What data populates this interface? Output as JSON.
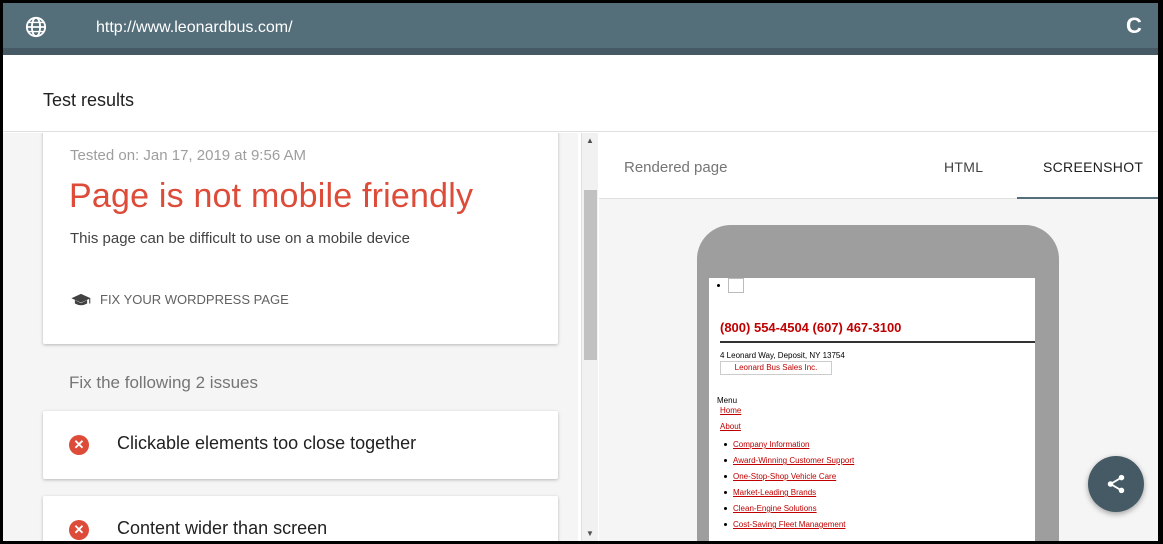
{
  "browser": {
    "url": "http://www.leonardbus.com/",
    "globe_icon": "globe-icon",
    "reload_icon": "reload-icon",
    "reload_glyph": "C"
  },
  "header": {
    "title": "Test results"
  },
  "result": {
    "tested_on": "Tested on: Jan 17, 2019 at 9:56 AM",
    "verdict": "Page is not mobile friendly",
    "subtitle": "This page can be difficult to use on a mobile device",
    "fix_link": "FIX YOUR WORDPRESS PAGE",
    "verdict_color": "#dd4b39"
  },
  "issues": {
    "title": "Fix the following 2 issues",
    "items": [
      {
        "label": "Clickable elements too close together",
        "icon": "error-icon"
      },
      {
        "label": "Content wider than screen",
        "icon": "error-icon"
      }
    ]
  },
  "preview": {
    "tab_title": "Rendered page",
    "tab_html": "HTML",
    "tab_screenshot": "SCREENSHOT",
    "phone_numbers": "(800) 554-4504 (607) 467-3100",
    "address": "4 Leonard Way, Deposit, NY 13754",
    "company_button": "Leonard Bus Sales Inc.",
    "menu_label": "Menu",
    "links": [
      "Home",
      "About"
    ],
    "sub_links": [
      "Company Information",
      "Award-Winning Customer Support",
      "One-Stop-Shop Vehicle Care",
      "Market-Leading Brands",
      "Clean-Engine Solutions",
      "Cost-Saving Fleet Management"
    ]
  },
  "colors": {
    "url_bar": "#546e7a",
    "accent_red": "#dd4b39",
    "fab": "#455a64"
  }
}
